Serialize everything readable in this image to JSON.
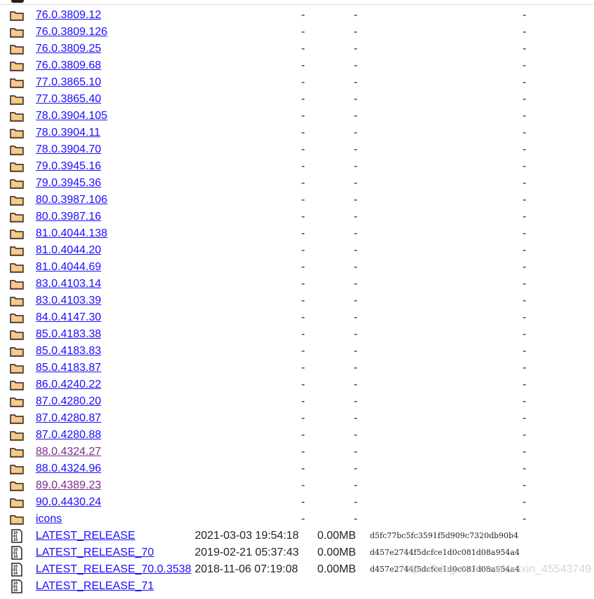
{
  "colors": {
    "link": "#1a0dff",
    "visited": "#7a2c8a",
    "folder": "#f9c98a"
  },
  "entries": [
    {
      "name": "76.0.3809.12",
      "type": "folder"
    },
    {
      "name": "76.0.3809.126",
      "type": "folder"
    },
    {
      "name": "76.0.3809.25",
      "type": "folder"
    },
    {
      "name": "76.0.3809.68",
      "type": "folder"
    },
    {
      "name": "77.0.3865.10",
      "type": "folder"
    },
    {
      "name": "77.0.3865.40",
      "type": "folder"
    },
    {
      "name": "78.0.3904.105",
      "type": "folder"
    },
    {
      "name": "78.0.3904.11",
      "type": "folder"
    },
    {
      "name": "78.0.3904.70",
      "type": "folder"
    },
    {
      "name": "79.0.3945.16",
      "type": "folder"
    },
    {
      "name": "79.0.3945.36",
      "type": "folder"
    },
    {
      "name": "80.0.3987.106",
      "type": "folder"
    },
    {
      "name": "80.0.3987.16",
      "type": "folder"
    },
    {
      "name": "81.0.4044.138",
      "type": "folder"
    },
    {
      "name": "81.0.4044.20",
      "type": "folder"
    },
    {
      "name": "81.0.4044.69",
      "type": "folder"
    },
    {
      "name": "83.0.4103.14",
      "type": "folder"
    },
    {
      "name": "83.0.4103.39",
      "type": "folder"
    },
    {
      "name": "84.0.4147.30",
      "type": "folder"
    },
    {
      "name": "85.0.4183.38",
      "type": "folder"
    },
    {
      "name": "85.0.4183.83",
      "type": "folder"
    },
    {
      "name": "85.0.4183.87",
      "type": "folder"
    },
    {
      "name": "86.0.4240.22",
      "type": "folder"
    },
    {
      "name": "87.0.4280.20",
      "type": "folder"
    },
    {
      "name": "87.0.4280.87",
      "type": "folder"
    },
    {
      "name": "87.0.4280.88",
      "type": "folder"
    },
    {
      "name": "88.0.4324.27",
      "type": "folder",
      "visited": true
    },
    {
      "name": "88.0.4324.96",
      "type": "folder"
    },
    {
      "name": "89.0.4389.23",
      "type": "folder",
      "visited": true
    },
    {
      "name": "90.0.4430.24",
      "type": "folder"
    },
    {
      "name": "icons",
      "type": "folder"
    },
    {
      "name": "LATEST_RELEASE",
      "type": "file",
      "date": "2021-03-03 19:54:18",
      "size": "0.00MB",
      "hash": "d5fc77bc5fc3591f5d909c7320db90b4"
    },
    {
      "name": "LATEST_RELEASE_70",
      "type": "file",
      "date": "2019-02-21 05:37:43",
      "size": "0.00MB",
      "hash": "d457e2744f5dcfce1d0c081d08a954a4"
    },
    {
      "name": "LATEST_RELEASE_70.0.3538",
      "type": "file",
      "date": "2018-11-06 07:19:08",
      "size": "0.00MB",
      "hash": "d457e2744f5dcfce1d0c081d08a954a4"
    },
    {
      "name": "LATEST_RELEASE_71",
      "type": "file"
    }
  ],
  "folder_placeholder": "-",
  "watermark": "https://blog.csdn.net/weixin_45543749"
}
